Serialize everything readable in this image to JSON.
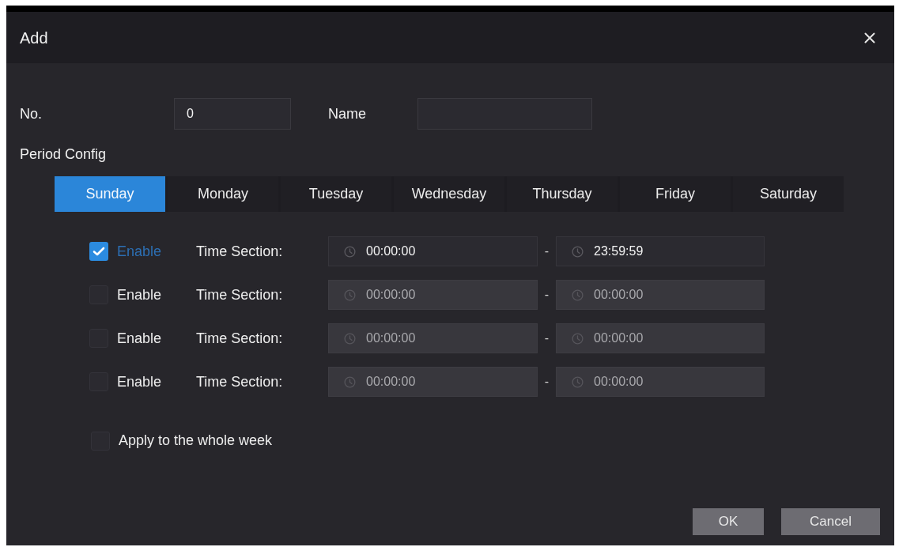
{
  "dialog": {
    "title": "Add"
  },
  "fields": [
    {
      "label": "No.",
      "value": "0"
    },
    {
      "label": "Name"
    }
  ],
  "section_label": "Period Config",
  "tabs": [
    {
      "label": "Sunday",
      "selected": true
    },
    {
      "label": "Monday",
      "selected": false
    },
    {
      "label": "Tuesday",
      "selected": false
    },
    {
      "label": "Wednesday",
      "selected": false
    },
    {
      "label": "Thursday",
      "selected": false
    },
    {
      "label": "Friday",
      "selected": false
    },
    {
      "label": "Saturday",
      "selected": false
    }
  ],
  "time_sections": [
    {
      "checkbox_label": "Enable",
      "checked": true,
      "label": "Time Section:",
      "start": "00:00:00",
      "separator": "-",
      "end": "23:59:59"
    },
    {
      "checkbox_label": "Enable",
      "checked": false,
      "label": "Time Section:",
      "start": "00:00:00",
      "separator": "-",
      "end": "00:00:00"
    },
    {
      "checkbox_label": "Enable",
      "checked": false,
      "label": "Time Section:",
      "start": "00:00:00",
      "separator": "-",
      "end": "00:00:00"
    },
    {
      "checkbox_label": "Enable",
      "checked": false,
      "label": "Time Section:",
      "start": "00:00:00",
      "separator": "-",
      "end": "00:00:00"
    }
  ],
  "apply_week": {
    "label": "Apply to the whole week",
    "checked": false
  },
  "buttons": [
    {
      "label": "OK"
    },
    {
      "label": "Cancel"
    }
  ]
}
